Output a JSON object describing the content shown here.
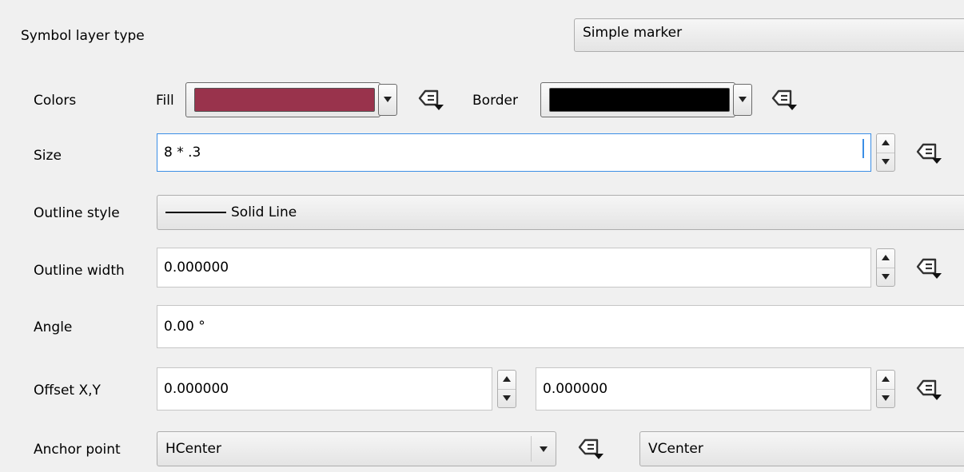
{
  "symbol_layer_type": {
    "label": "Symbol layer type",
    "value": "Simple marker"
  },
  "colors": {
    "label": "Colors",
    "fill_label": "Fill",
    "fill_color": "#99334c",
    "border_label": "Border",
    "border_color": "#000000"
  },
  "size": {
    "label": "Size",
    "value": "8 * .3"
  },
  "outline_style": {
    "label": "Outline style",
    "value": "Solid Line"
  },
  "outline_width": {
    "label": "Outline width",
    "value": "0.000000"
  },
  "angle": {
    "label": "Angle",
    "value": "0.00 °"
  },
  "offset": {
    "label": "Offset X,Y",
    "x": "0.000000",
    "y": "0.000000"
  },
  "anchor_point": {
    "label": "Anchor point",
    "horizontal": "HCenter",
    "vertical": "VCenter"
  },
  "icons": {
    "data_defined_override": "data-defined-override-icon",
    "spin_up": "triangle-up-icon",
    "spin_down": "triangle-down-icon",
    "dropdown": "triangle-down-icon"
  }
}
